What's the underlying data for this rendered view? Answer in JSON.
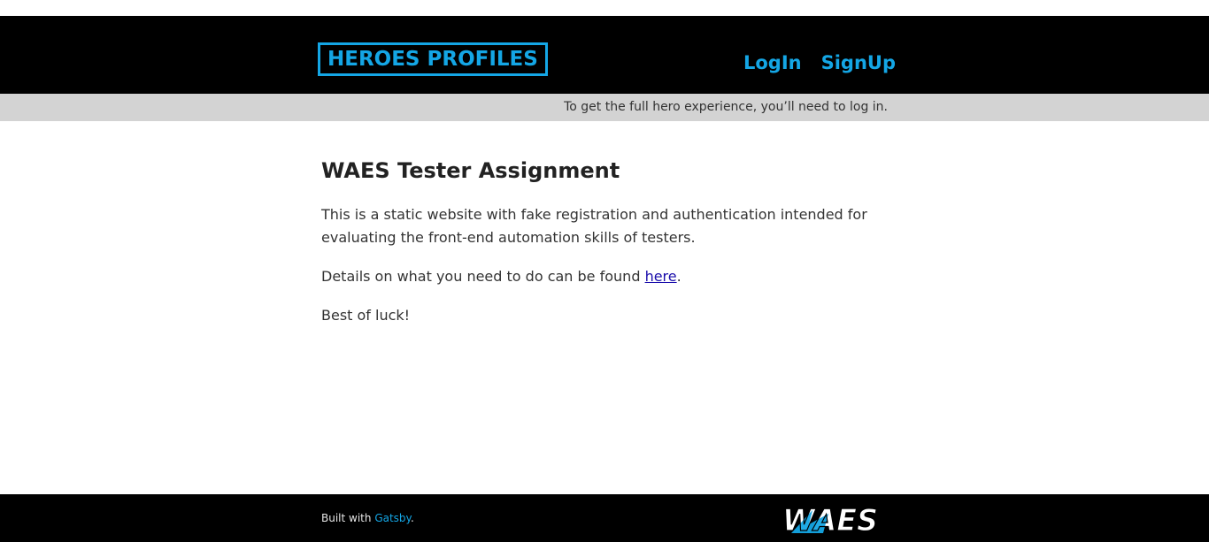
{
  "header": {
    "brand": "HEROES PROFILES",
    "nav": [
      {
        "label": "LogIn"
      },
      {
        "label": "SignUp"
      }
    ]
  },
  "notice": {
    "text": "To get the full hero experience, you’ll need to log in."
  },
  "main": {
    "title": "WAES Tester Assignment",
    "intro": "This is a static website with fake registration and authentication intended for evaluating the front-end automation skills of testers.",
    "details_prefix": "Details on what you need to do can be found ",
    "details_link": "here",
    "details_suffix": ".",
    "closing": "Best of luck!"
  },
  "footer": {
    "built_prefix": "Built with ",
    "built_link": "Gatsby",
    "built_suffix": ".",
    "logo_text": "WAES"
  },
  "colors": {
    "accent": "#14a6e5",
    "header_bg": "#000000",
    "notice_bg": "#d3d3d3",
    "link": "#1a0dab"
  }
}
